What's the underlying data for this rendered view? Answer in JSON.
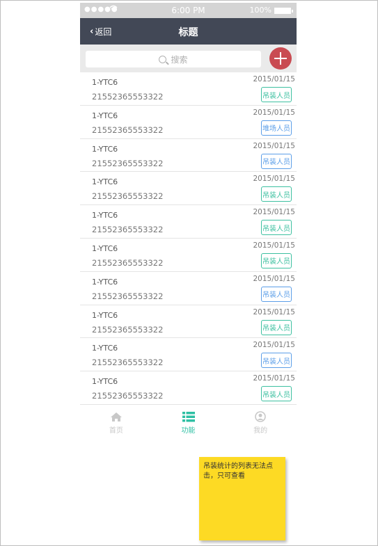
{
  "status_bar": {
    "signal": "●●●●●",
    "time": "6:00 PM",
    "battery": "100%"
  },
  "nav": {
    "back_label": "返回",
    "title": "标题"
  },
  "search": {
    "placeholder": "搜索"
  },
  "list": {
    "items": [
      {
        "name": "1-YTC6",
        "code": "21552365553322",
        "date": "2015/01/15",
        "badge": "吊装人员",
        "badge_color": "green"
      },
      {
        "name": "1-YTC6",
        "code": "21552365553322",
        "date": "2015/01/15",
        "badge": "堆场人员",
        "badge_color": "blue"
      },
      {
        "name": "1-YTC6",
        "code": "21552365553322",
        "date": "2015/01/15",
        "badge": "吊装人员",
        "badge_color": "blue"
      },
      {
        "name": "1-YTC6",
        "code": "21552365553322",
        "date": "2015/01/15",
        "badge": "吊装人员",
        "badge_color": "green"
      },
      {
        "name": "1-YTC6",
        "code": "21552365553322",
        "date": "2015/01/15",
        "badge": "吊装人员",
        "badge_color": "green"
      },
      {
        "name": "1-YTC6",
        "code": "21552365553322",
        "date": "2015/01/15",
        "badge": "吊装人员",
        "badge_color": "green"
      },
      {
        "name": "1-YTC6",
        "code": "21552365553322",
        "date": "2015/01/15",
        "badge": "吊装人员",
        "badge_color": "blue"
      },
      {
        "name": "1-YTC6",
        "code": "21552365553322",
        "date": "2015/01/15",
        "badge": "吊装人员",
        "badge_color": "green"
      },
      {
        "name": "1-YTC6",
        "code": "21552365553322",
        "date": "2015/01/15",
        "badge": "吊装人员",
        "badge_color": "blue"
      },
      {
        "name": "1-YTC6",
        "code": "21552365553322",
        "date": "2015/01/15",
        "badge": "吊装人员",
        "badge_color": "green"
      }
    ]
  },
  "tabbar": {
    "tabs": [
      {
        "label": "首页",
        "icon": "home-icon",
        "active": false
      },
      {
        "label": "功能",
        "icon": "list-icon",
        "active": true
      },
      {
        "label": "我的",
        "icon": "user-icon",
        "active": false
      }
    ]
  },
  "note": {
    "text": "吊装统计的列表无法点击，只可查看"
  },
  "colors": {
    "navbar": "#424856",
    "accent": "#2fc0a4",
    "add_button": "#c94b52",
    "badge_green": "#3cc0a0",
    "badge_blue": "#5b9ee8",
    "note": "#fdda24"
  }
}
